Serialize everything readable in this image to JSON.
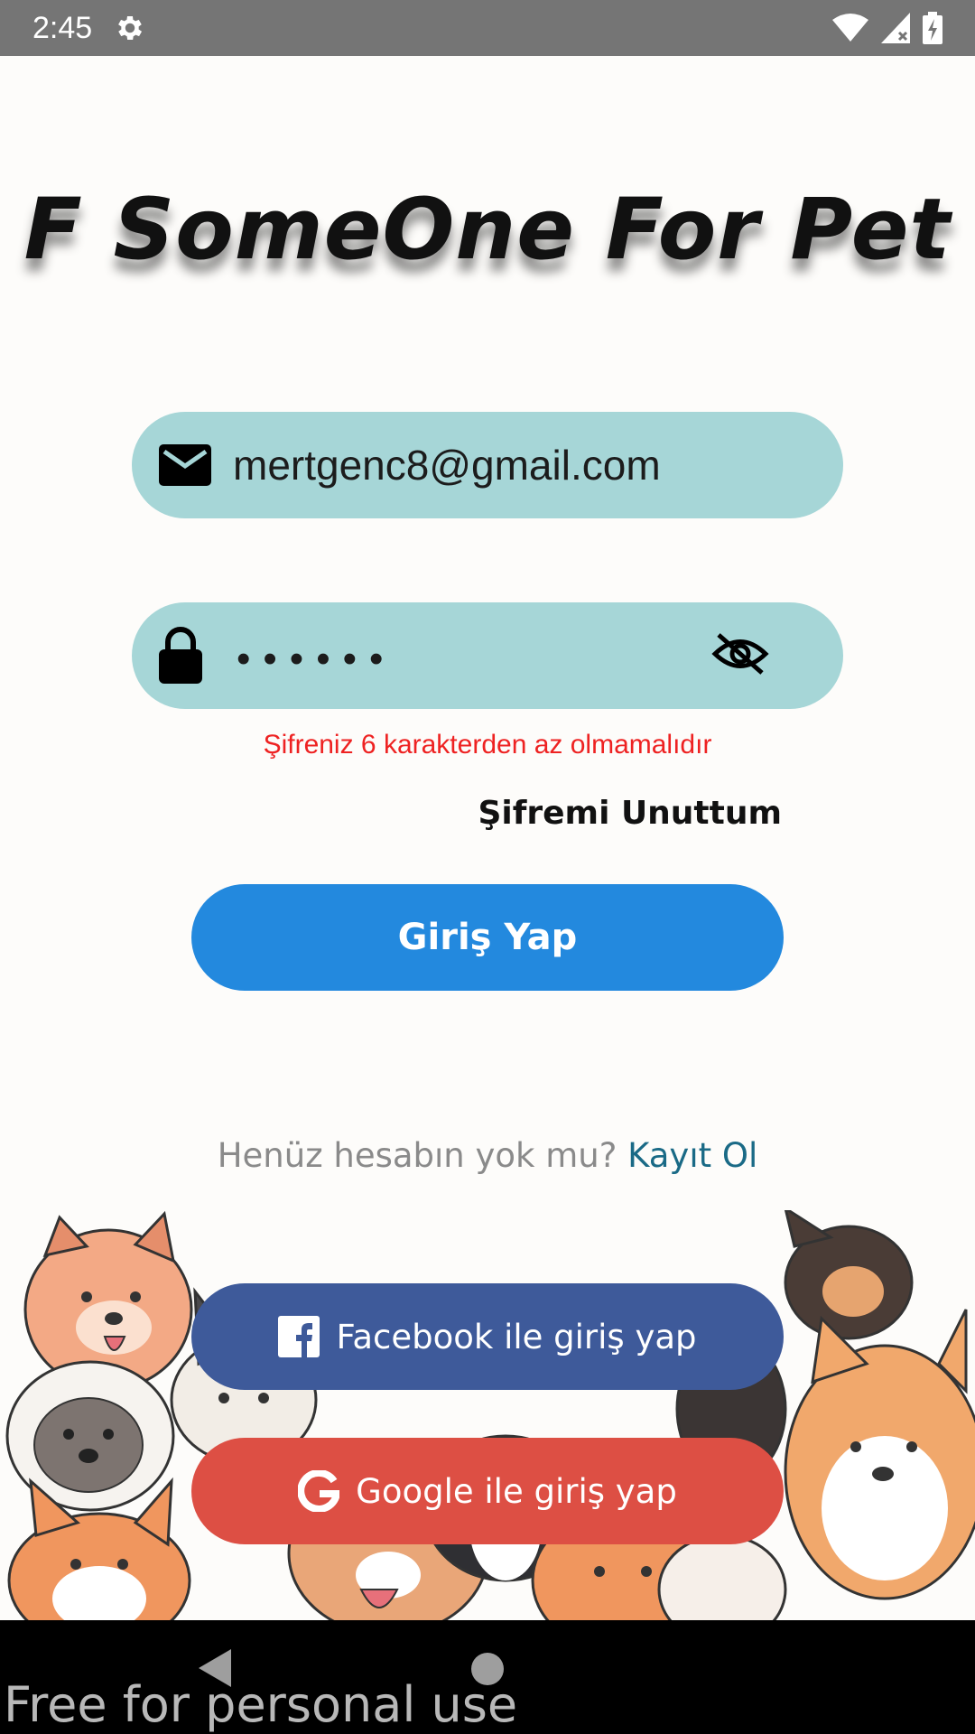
{
  "status_bar": {
    "time": "2:45"
  },
  "app": {
    "logo_text": "F SomeOne For Pet"
  },
  "login_form": {
    "email_value": "mertgenc8@gmail.com",
    "password_masked": "••••••",
    "error_message": "Şifreniz 6 karakterden az olmamalıdır",
    "forgot_password": "Şifremi Unuttum",
    "login_button": "Giriş Yap"
  },
  "signup_prompt": {
    "text": "Henüz hesabın yok mu?",
    "link": "Kayıt Ol"
  },
  "social": {
    "facebook_button": "Facebook ile giriş yap",
    "google_button": "Google ile giriş yap"
  },
  "watermark": "Free for personal use",
  "colors": {
    "field_bg": "#a6d6d7",
    "login_button": "#2389de",
    "facebook_button": "#3e5a9a",
    "google_button": "#dd4f44",
    "error_text": "#ee2222",
    "link_text": "#1a6a86"
  },
  "icons": {
    "email": "mail-icon",
    "password": "lock-icon",
    "visibility": "eye-off-icon",
    "facebook": "facebook-icon",
    "google": "google-icon"
  }
}
